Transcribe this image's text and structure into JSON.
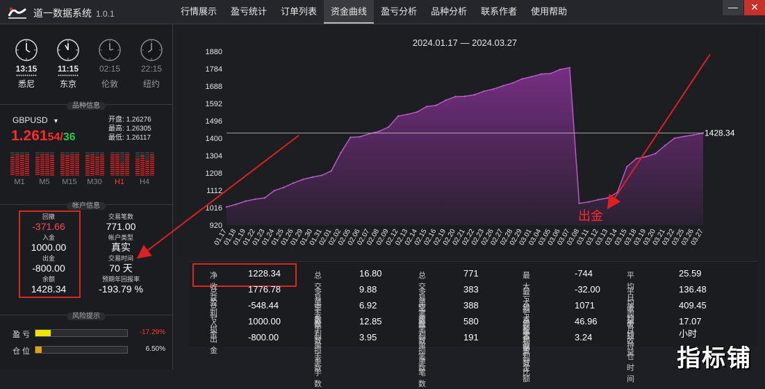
{
  "app": {
    "title": "道一数据系统",
    "version": "1.0.1"
  },
  "menu": [
    "行情展示",
    "盈亏统计",
    "订单列表",
    "资金曲线",
    "盈亏分析",
    "品种分析",
    "联系作者",
    "使用帮助"
  ],
  "active_menu": "资金曲线",
  "window_buttons": {
    "minimize": "—",
    "close": "✕"
  },
  "clocks": [
    {
      "time": "13:15",
      "city": "悉尼",
      "active": true
    },
    {
      "time": "11:15",
      "city": "东京",
      "active": true
    },
    {
      "time": "02:15",
      "city": "伦敦",
      "active": false
    },
    {
      "time": "22:15",
      "city": "纽约",
      "active": false
    }
  ],
  "sections": {
    "symbol_info": "品种信息",
    "account_info": "帐户信息",
    "risk": "风险提示"
  },
  "symbol": {
    "name": "GBPUSD",
    "price_main": "1.261",
    "bid_tail": "54",
    "separator": "/",
    "ask_tail": "36",
    "open_label": "开盘:",
    "open": "1.26276",
    "high_label": "最高:",
    "high": "1.26305",
    "low_label": "最低:",
    "low": "1.26117"
  },
  "timeframes": [
    {
      "label": "M1",
      "hot": false,
      "levels": [
        0.8,
        0.9,
        0.85,
        0.9
      ]
    },
    {
      "label": "M5",
      "hot": false,
      "levels": [
        0.8,
        0.9,
        0.9,
        0.85
      ]
    },
    {
      "label": "M15",
      "hot": false,
      "levels": [
        0.9,
        0.85,
        0.9,
        0.9
      ]
    },
    {
      "label": "M30",
      "hot": false,
      "levels": [
        0.85,
        0.9,
        0.8,
        0.9
      ]
    },
    {
      "label": "H1",
      "hot": true,
      "levels": [
        0.9,
        0.9,
        0.55,
        0.9
      ]
    },
    {
      "label": "H4",
      "hot": false,
      "levels": [
        0.75,
        0.85,
        0.65,
        0.9
      ]
    }
  ],
  "account": {
    "pullback_label": "回撤",
    "pullback": "-371.66",
    "deposit_label": "入金",
    "deposit": "1000.00",
    "withdraw_label": "出金",
    "withdraw": "-800.00",
    "balance_label": "余额",
    "balance": "1428.34",
    "trades_label": "交易笔数",
    "trades": "771.00",
    "type_label": "帐户类型",
    "type": "真实",
    "time_label": "交易时间",
    "time": "70 天",
    "annual_label": "预期年回报率",
    "annual": "-193.79 %"
  },
  "risk": {
    "pnl_label": "盈 亏",
    "pnl_value": "-17.29%",
    "pnl_level": 0.17,
    "pnl_color": "#f2e200",
    "pos_label": "仓 位",
    "pos_value": "6.50%",
    "pos_level": 0.065,
    "pos_color": "#e8a000"
  },
  "chart_data": {
    "type": "area",
    "title": "2024.01.17 — 2024.03.27",
    "yticks": [
      1880,
      1784,
      1688,
      1592,
      1496,
      1400,
      1304,
      1208,
      1112,
      1016,
      920
    ],
    "ylim": [
      920,
      1880
    ],
    "categories": [
      "01.17",
      "01.18",
      "01.19",
      "01.22",
      "01.23",
      "01.24",
      "01.25",
      "01.26",
      "01.29",
      "01.30",
      "01.31",
      "02.01",
      "02.02",
      "02.05",
      "02.06",
      "02.07",
      "02.08",
      "02.09",
      "02.12",
      "02.13",
      "02.14",
      "02.15",
      "02.16",
      "02.19",
      "02.20",
      "02.21",
      "02.22",
      "02.23",
      "02.26",
      "02.27",
      "02.28",
      "02.29",
      "03.01",
      "03.04",
      "03.05",
      "03.06",
      "03.07",
      "03.08",
      "03.11",
      "03.12",
      "03.13",
      "03.14",
      "03.15",
      "03.18",
      "03.19",
      "03.20",
      "03.21",
      "03.22",
      "03.25",
      "03.26",
      "03.27"
    ],
    "values": [
      1020,
      1035,
      1052,
      1063,
      1070,
      1110,
      1128,
      1152,
      1172,
      1185,
      1195,
      1220,
      1320,
      1405,
      1408,
      1425,
      1438,
      1462,
      1522,
      1532,
      1545,
      1575,
      1582,
      1610,
      1630,
      1632,
      1640,
      1660,
      1672,
      1690,
      1705,
      1728,
      1740,
      1755,
      1758,
      1780,
      1790,
      1040,
      1048,
      1060,
      1070,
      1100,
      1242,
      1288,
      1298,
      1315,
      1360,
      1400,
      1410,
      1418,
      1428.34
    ],
    "last_label": "1428.34",
    "reference_value": 1428.34,
    "annotation": "出金",
    "area_color": "#7a2f86",
    "line_color": "#b65ac4"
  },
  "stats": {
    "col1": [
      {
        "k": "净收益",
        "v": "1228.34"
      },
      {
        "k": "总盈利",
        "v": "1776.78"
      },
      {
        "k": "总亏损",
        "v": "-548.44"
      },
      {
        "k": "入金",
        "v": "1000.00"
      },
      {
        "k": "出金",
        "v": "-800.00"
      }
    ],
    "col2": [
      {
        "k": "总交易手数",
        "v": "16.80"
      },
      {
        "k": "多单手数",
        "v": "9.88"
      },
      {
        "k": "空单手数",
        "v": "6.92"
      },
      {
        "k": "盈利单手数",
        "v": "12.85"
      },
      {
        "k": "亏损单手数",
        "v": "3.95"
      }
    ],
    "col3": [
      {
        "k": "总交易笔数",
        "v": "771"
      },
      {
        "k": "多单笔数",
        "v": "383"
      },
      {
        "k": "空单笔数",
        "v": "388"
      },
      {
        "k": "盈利单笔数",
        "v": "580"
      },
      {
        "k": "亏损单笔数",
        "v": "191"
      }
    ],
    "col4": [
      {
        "k": "最大亏损点数",
        "v": "-744"
      },
      {
        "k": "最大亏损金额",
        "v": "-32.00"
      },
      {
        "k": "最大盈利点数",
        "v": "1071"
      },
      {
        "k": "最大盈利金额",
        "v": "46.96"
      },
      {
        "k": "总盈亏比",
        "v": "3.24"
      }
    ],
    "col5": [
      {
        "k": "平均日收益",
        "v": "25.59"
      },
      {
        "k": "平均周收益",
        "v": "136.48"
      },
      {
        "k": "平均月收益",
        "v": "409.45"
      },
      {
        "k": "平均持仓时间",
        "v": "17.07小时"
      }
    ]
  },
  "watermark": "指标铺"
}
